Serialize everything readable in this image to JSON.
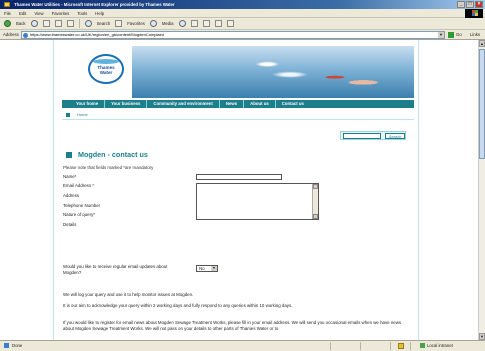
{
  "window": {
    "title": "Thames Water Utilities - Microsoft Internet Explorer provided by Thames Water"
  },
  "menu": [
    "File",
    "Edit",
    "View",
    "Favorites",
    "Tools",
    "Help"
  ],
  "toolbar": {
    "back_label": "Back",
    "search_label": "Search",
    "favorites_label": "Favorites",
    "media_label": "Media"
  },
  "address": {
    "label": "Address",
    "url": "https://www.thameswater.co.uk/UK/region/en_gb/content/MogdenComplaint",
    "go_label": "Go",
    "links_label": "Links"
  },
  "site": {
    "logo_line1": "Thames",
    "logo_line2": "Water",
    "nav": [
      "Your home",
      "Your business",
      "Community and environment",
      "News",
      "About us",
      "Contact us"
    ],
    "breadcrumb": "Home",
    "search_button": "Search"
  },
  "form": {
    "title": "Mogden - contact us",
    "mandatory_note": "Please note that fields marked *are mandatory",
    "fields": [
      {
        "label": "Name*"
      },
      {
        "label": "Email Address *"
      },
      {
        "label": "Address"
      },
      {
        "label": "Telephone Number"
      },
      {
        "label": "Nature of query*"
      },
      {
        "label": "Details"
      }
    ],
    "updates_label": "Would you like to receive regular email updates about Mogden?",
    "updates_value": "No"
  },
  "paragraphs": [
    "We will log your query and use it to help monitor issues at Mogden.",
    "It is our aim to acknowledge your query within 2 working days and fully respond to any queries within 10 working days.",
    "If you would like to register for email news about Mogden Sewage Treatment Works, please fill in your email address. We will send you occasional emails when we have news about Mogden Sewage Treatment Works. We will not pass on your details to other parts of Thames Water or to"
  ],
  "status": {
    "left": "Done",
    "zone": "Local intranet"
  },
  "colors": {
    "teal": "#1e7f8c",
    "xp_blue": "#0a246a"
  }
}
